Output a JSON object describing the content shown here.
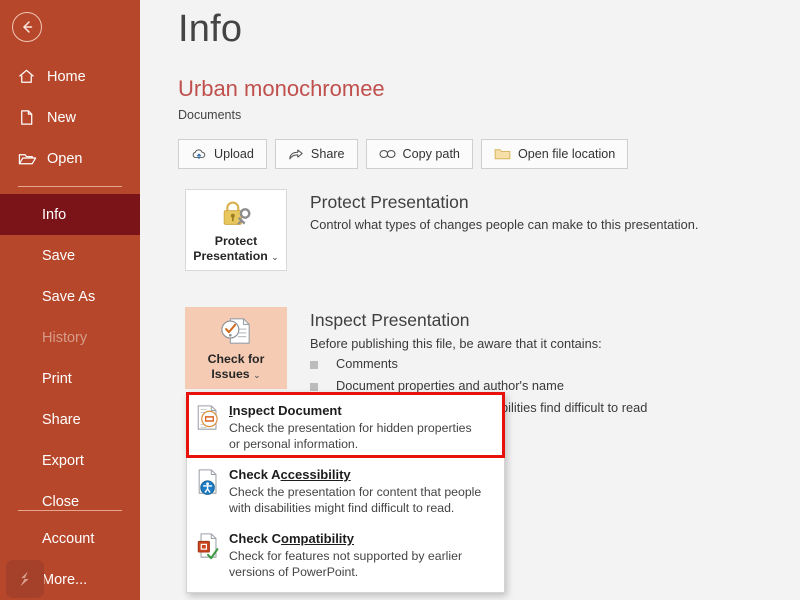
{
  "app": {
    "back_icon": "back-arrow-icon",
    "taskbar_icon": "powerpoint-app-icon"
  },
  "sidebar": {
    "top_items": [
      {
        "label": "Home",
        "icon": "home-icon"
      },
      {
        "label": "New",
        "icon": "new-document-icon"
      },
      {
        "label": "Open",
        "icon": "open-folder-icon"
      }
    ],
    "main_items": [
      {
        "label": "Info",
        "state": "selected"
      },
      {
        "label": "Save",
        "state": "normal"
      },
      {
        "label": "Save As",
        "state": "normal"
      },
      {
        "label": "History",
        "state": "disabled"
      },
      {
        "label": "Print",
        "state": "normal"
      },
      {
        "label": "Share",
        "state": "normal"
      },
      {
        "label": "Export",
        "state": "normal"
      },
      {
        "label": "Close",
        "state": "normal"
      }
    ],
    "bottom_items": [
      {
        "label": "Account",
        "state": "normal"
      },
      {
        "label": "More...",
        "state": "normal"
      }
    ]
  },
  "header": {
    "page_title": "Info",
    "document_title": "Urban monochromee",
    "document_location": "Documents"
  },
  "toolbar": {
    "buttons": [
      {
        "label": "Upload",
        "icon": "cloud-upload-icon"
      },
      {
        "label": "Share",
        "icon": "share-icon"
      },
      {
        "label": "Copy path",
        "icon": "link-icon"
      },
      {
        "label": "Open file location",
        "icon": "folder-icon"
      }
    ]
  },
  "protect_section": {
    "button_line1": "Protect",
    "button_line2": "Presentation",
    "button_icon": "lock-key-icon",
    "caret": "⌄",
    "heading": "Protect Presentation",
    "description": "Control what types of changes people can make to this presentation."
  },
  "inspect_section": {
    "button_line1": "Check for",
    "button_line2": "Issues",
    "button_icon": "document-check-icon",
    "caret": "⌄",
    "heading": "Inspect Presentation",
    "description": "Before publishing this file, be aware that it contains:",
    "bullets": [
      "Comments",
      "Document properties and author's name",
      "Content that people with disabilities find difficult to read"
    ]
  },
  "dropdown_menu": {
    "highlighted_item": "Inspect Document",
    "highlight_color": "#e8120c",
    "items": [
      {
        "title_prefix": "I",
        "title_rest": "nspect Document",
        "icon": "inspect-document-icon",
        "desc_line1": "Check the presentation for hidden properties",
        "desc_line2": "or personal information."
      },
      {
        "title_prefix": "Check A",
        "title_rest": "ccessibility",
        "icon": "accessibility-icon",
        "desc_line1": "Check the presentation for content that people",
        "desc_line2": "with disabilities might find difficult to read."
      },
      {
        "title_prefix": "Check C",
        "title_rest": "ompatibility",
        "icon": "compatibility-icon",
        "desc_line1": "Check for features not supported by earlier",
        "desc_line2": "versions of PowerPoint."
      }
    ]
  },
  "colors": {
    "sidebar": "#b7472a",
    "sidebar_selected": "#7a1419",
    "accent_title": "#c0504d",
    "page_bg": "#f3f3f3",
    "hover_button": "#f6cbb4"
  }
}
